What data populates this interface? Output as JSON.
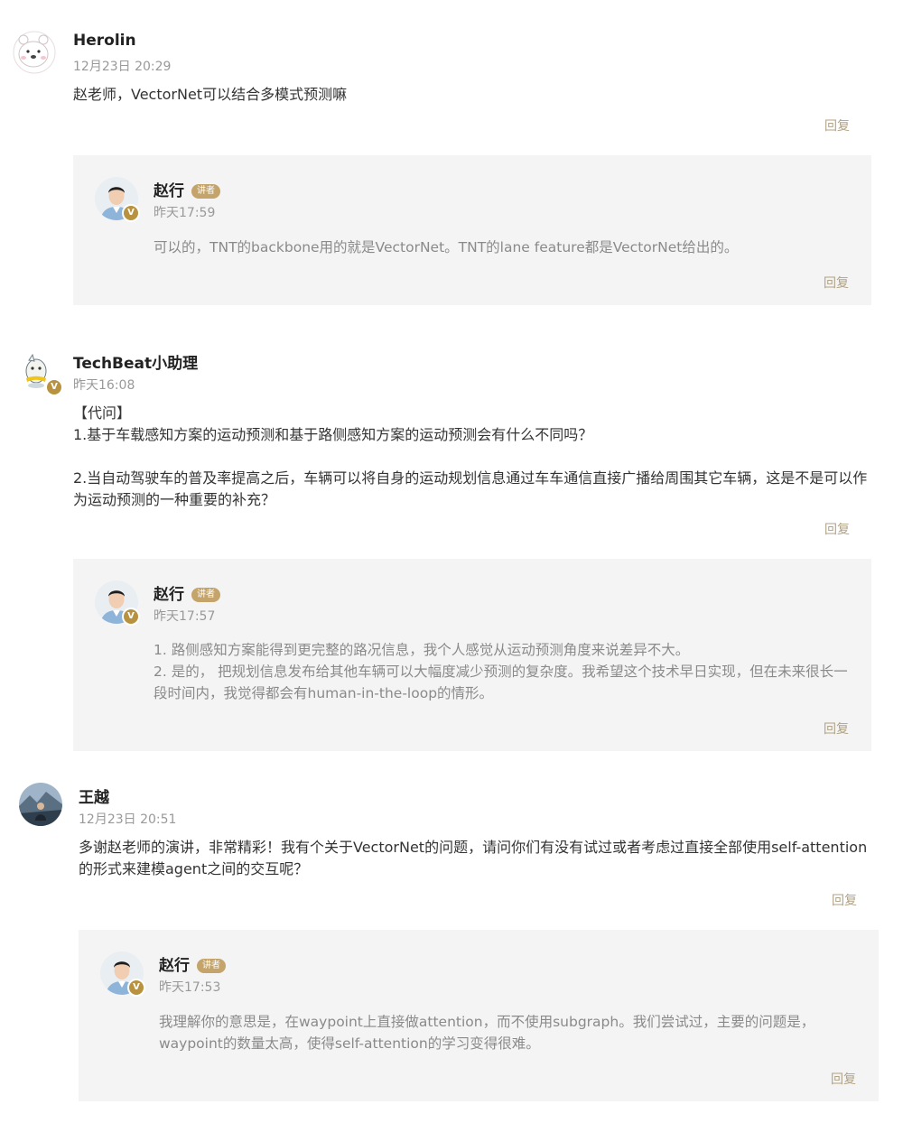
{
  "comments": [
    {
      "author": "Herolin",
      "time": "12月23日 20:29",
      "text": [
        "赵老师，VectorNet可以结合多模式预测嘛"
      ],
      "reply_label": "回复",
      "reply": {
        "author": "赵行",
        "tag": "讲者",
        "time": "昨天17:59",
        "text": [
          "可以的，TNT的backbone用的就是VectorNet。TNT的lane feature都是VectorNet给出的。"
        ],
        "reply_label": "回复"
      }
    },
    {
      "author": "TechBeat小助理",
      "time": "昨天16:08",
      "text": [
        "【代问】",
        "1.基于车载感知方案的运动预测和基于路侧感知方案的运动预测会有什么不同吗？",
        "",
        "2.当自动驾驶车的普及率提高之后，车辆可以将自身的运动规划信息通过车车通信直接广播给周围其它车辆，这是不是可以作为运动预测的一种重要的补充？"
      ],
      "reply_label": "回复",
      "reply": {
        "author": "赵行",
        "tag": "讲者",
        "time": "昨天17:57",
        "text": [
          "1. 路侧感知方案能得到更完整的路况信息，我个人感觉从运动预测角度来说差异不大。",
          "2. 是的， 把规划信息发布给其他车辆可以大幅度减少预测的复杂度。我希望这个技术早日实现，但在未来很长一段时间内，我觉得都会有human-in-the-loop的情形。"
        ],
        "reply_label": "回复"
      }
    },
    {
      "author": "王越",
      "time": "12月23日 20:51",
      "text": [
        "多谢赵老师的演讲，非常精彩！我有个关于VectorNet的问题，请问你们有没有试过或者考虑过直接全部使用self-attention的形式来建模agent之间的交互呢？"
      ],
      "reply_label": "回复",
      "reply": {
        "author": "赵行",
        "tag": "讲者",
        "time": "昨天17:53",
        "text": [
          "我理解你的意思是，在waypoint上直接做attention，而不使用subgraph。我们尝试过，主要的问题是，waypoint的数量太高，使得self-attention的学习变得很难。"
        ],
        "reply_label": "回复"
      }
    }
  ],
  "badge_glyph": "V",
  "colors": {
    "reply_link": "#b0a285",
    "tag": "#c4a46a",
    "badge": "#b8923f",
    "reply_bg": "#f4f4f4"
  }
}
